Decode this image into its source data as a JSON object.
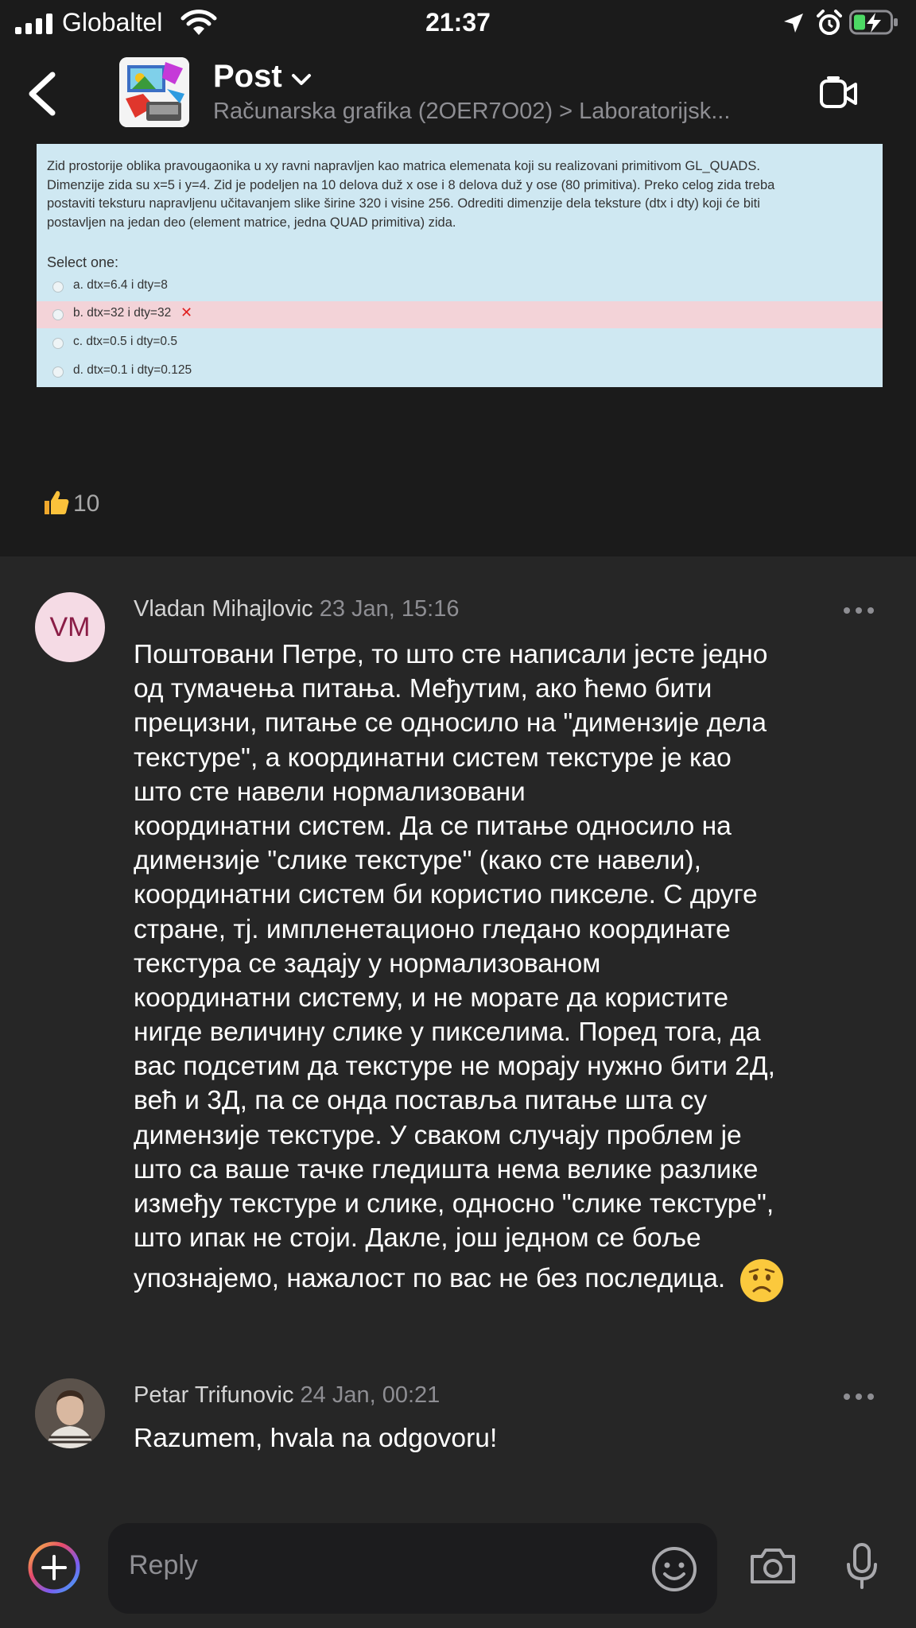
{
  "status_bar": {
    "carrier": "Globaltel",
    "time": "21:37"
  },
  "header": {
    "title": "Post",
    "breadcrumb": "Računarska grafika (2OER7O02) > Laboratorijsk..."
  },
  "quiz": {
    "question_lines": [
      "Zid prostorije oblika pravougaonika u xy ravni napravljen kao matrica elemenata koji su realizovani primitivom GL_QUADS.",
      "Dimenzije zida su x=5 i y=4. Zid je podeljen na 10 delova duž x ose i 8 delova duž y ose (80 primitiva). Preko celog zida treba",
      "postaviti teksturu napravljenu učitavanjem slike širine 320 i visine 256. Odrediti dimenzije dela teksture (dtx i dty) koji će biti",
      "postavljen na jedan deo (element matrice, jedna QUAD primitiva) zida."
    ],
    "select_label": "Select one:",
    "options": [
      {
        "label": "a. dtx=6.4 i dty=8"
      },
      {
        "label": "b. dtx=32 i dty=32"
      },
      {
        "label": "c. dtx=0.5 i dty=0.5"
      },
      {
        "label": "d. dtx=0.1 i dty=0.125"
      }
    ],
    "wrong_mark": "✕"
  },
  "reactions": {
    "count": "10"
  },
  "comments": [
    {
      "initials": "VM",
      "author": "Vladan Mihajlovic",
      "date": "23 Jan, 15:16",
      "lines": [
        "Поштовани Петре, то што сте написали јесте једно",
        "од тумачења питања. Међутим, ако ћемо бити",
        "прецизни, питање се односило на \"димензије дела",
        "текстуре\", а координатни систем текстуре је као",
        "што сте навели нормализовани",
        "координатни систем. Да се питање односило на",
        "димензије \"слике текстуре\" (како сте навели),",
        "координатни систем би користио пикселе. С друге",
        "стране, тј. импленетационо гледано координате",
        "текстура се задају у нормализованом",
        "координатни систему, и не морате да користите",
        "нигде величину слике у пикселима. Поред тога, да",
        "вас подсетим да текстуре не морају нужно бити 2Д,",
        "већ и 3Д, па се онда поставља питање шта су",
        "димензије текстуре. У сваком случају проблем је",
        "што са ваше тачке гледишта нема велике разлике",
        "између текстуре и слике, односно \"слике текстуре\",",
        "што ипак не стоји. Дакле, још једном се боље",
        "упознајемо, нажалост по вас не без последица."
      ]
    },
    {
      "author": "Petar Trifunovic",
      "date": "24 Jan, 00:21",
      "text": "Razumem, hvala na odgovoru!"
    }
  ],
  "reply": {
    "placeholder": "Reply"
  },
  "colors": {
    "background": "#262626",
    "top_background": "#1b1b1b",
    "reply_field": "#1c1c1e",
    "battery": "#4cd964",
    "wrong_row": "#f3d3d8",
    "quiz_bg": "#cfe8f2"
  },
  "icons": [
    "signal-icon",
    "wifi-icon",
    "location-icon",
    "alarm-icon",
    "battery-icon",
    "back-icon",
    "chevron-down-icon",
    "video-call-icon",
    "thumbs-up-icon",
    "more-icon",
    "sad-emoji-icon",
    "plus-icon",
    "smiley-icon",
    "camera-icon",
    "microphone-icon"
  ]
}
